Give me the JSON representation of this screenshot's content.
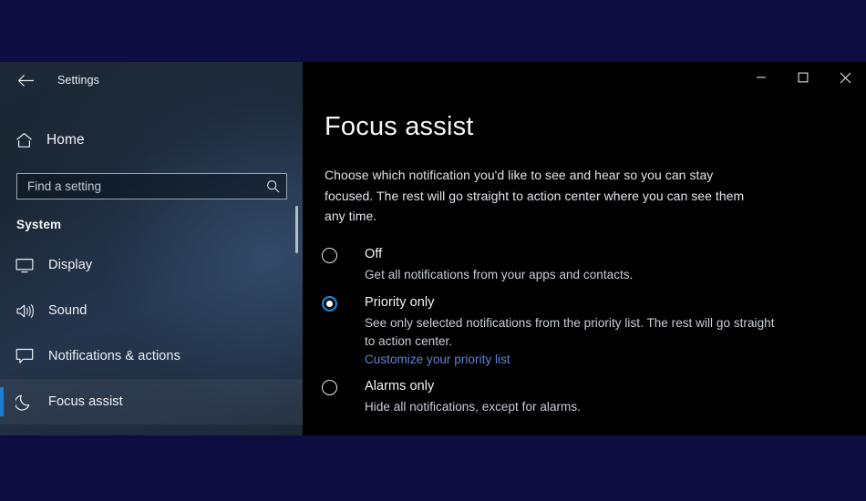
{
  "window": {
    "titlebar_text": "Settings",
    "back_icon": "back-arrow-icon",
    "controls": {
      "minimize": "minimize-icon",
      "maximize": "maximize-icon",
      "close": "close-icon"
    }
  },
  "sidebar": {
    "home": {
      "label": "Home",
      "icon": "home-icon"
    },
    "search": {
      "placeholder": "Find a setting",
      "value": "",
      "icon": "search-icon"
    },
    "group_header": "System",
    "items": [
      {
        "label": "Display",
        "icon": "monitor-icon",
        "selected": false
      },
      {
        "label": "Sound",
        "icon": "speaker-icon",
        "selected": false
      },
      {
        "label": "Notifications & actions",
        "icon": "notification-bubble-icon",
        "selected": false
      },
      {
        "label": "Focus assist",
        "icon": "moon-icon",
        "selected": true
      }
    ],
    "accent_color": "#1a7fd4"
  },
  "main": {
    "title": "Focus assist",
    "description": "Choose which notification you'd like to see and hear so you can stay focused. The rest will go straight to action center where you can see them any time.",
    "options": [
      {
        "label": "Off",
        "description": "Get all notifications from your apps and contacts.",
        "selected": false,
        "link": ""
      },
      {
        "label": "Priority only",
        "description": "See only selected notifications from the priority list. The rest will go straight to action center.",
        "selected": true,
        "link": "Customize your priority list"
      },
      {
        "label": "Alarms only",
        "description": "Hide all notifications, except for alarms.",
        "selected": false,
        "link": ""
      }
    ],
    "link_color": "#5f84d8",
    "radio_checked_color": "#1d8bd8"
  }
}
